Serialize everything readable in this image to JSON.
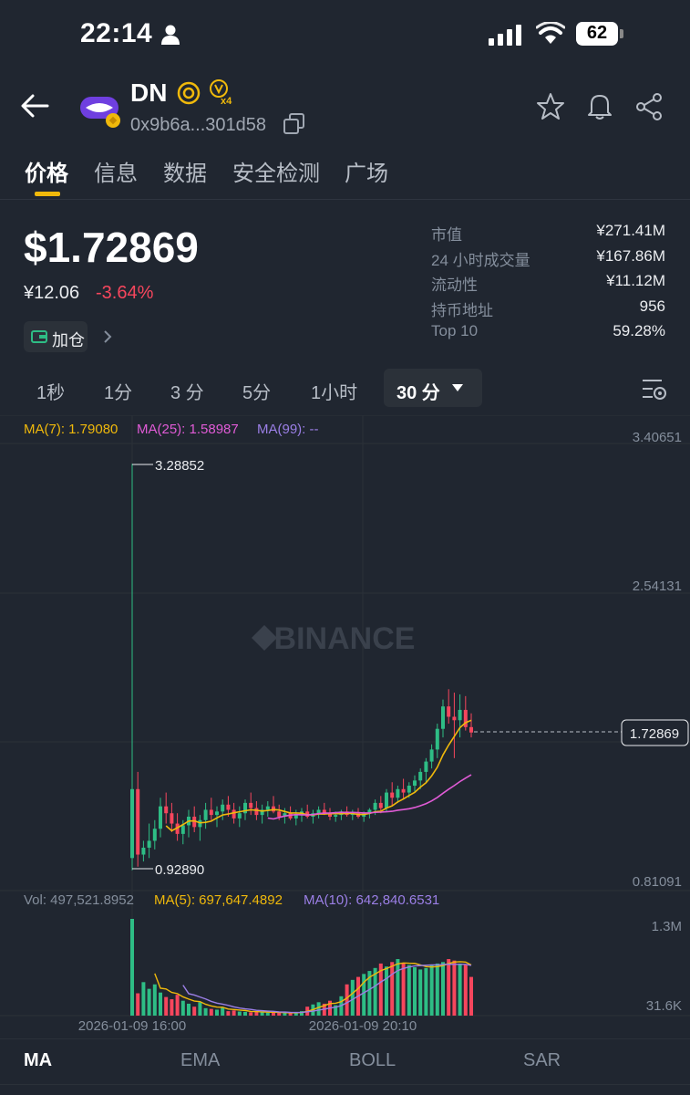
{
  "status": {
    "time": "22:14",
    "battery": "62"
  },
  "token": {
    "name": "DN",
    "address": "0x9b6a...301d58"
  },
  "tabs": [
    "价格",
    "信息",
    "数据",
    "安全检测",
    "广场"
  ],
  "price": {
    "usd": "$1.72869",
    "cny": "¥12.06",
    "change": "-3.64%",
    "add_label": "加仓"
  },
  "stats": [
    {
      "label": "市值",
      "value": "¥271.41M"
    },
    {
      "label": "24 小时成交量",
      "value": "¥167.86M"
    },
    {
      "label": "流动性",
      "value": "¥11.12M"
    },
    {
      "label": "持币地址",
      "value": "956"
    },
    {
      "label": "Top 10",
      "value": "59.28%"
    }
  ],
  "intervals": [
    "1秒",
    "1分",
    "3 分",
    "5分",
    "1小时"
  ],
  "interval_selected": "30 分",
  "ma": {
    "ma7": "MA(7): 1.79080",
    "ma25": "MA(25): 1.58987",
    "ma99": "MA(99): --"
  },
  "price_axis": [
    "3.40651",
    "2.54131",
    "0.81091"
  ],
  "current_price_tag": "1.72869",
  "high_label": "3.28852",
  "low_label": "0.92890",
  "watermark": "BINANCE",
  "volume": {
    "vol": "Vol: 497,521.8952",
    "ma5": "MA(5): 697,647.4892",
    "ma10": "MA(10): 642,840.6531",
    "axis_top": "1.3M",
    "axis_bottom": "31.6K"
  },
  "time_axis": [
    "2026-01-09 16:00",
    "2026-01-09 20:10"
  ],
  "bottom_tabs": [
    "MA",
    "EMA",
    "BOLL",
    "SAR"
  ],
  "colors": {
    "up": "#2ebd85",
    "down": "#f6465d",
    "accent": "#f0b90b",
    "ma7": "#f0b90b",
    "ma25": "#e05bd6",
    "ma10": "#9b7fe6"
  },
  "chart_data": {
    "type": "candlestick",
    "ylim": [
      0.81091,
      3.40651
    ],
    "candles": [
      [
        1.0,
        3.28852,
        0.9289,
        1.4
      ],
      [
        1.4,
        1.5,
        0.95,
        1.02
      ],
      [
        1.02,
        1.1,
        0.98,
        1.06
      ],
      [
        1.06,
        1.2,
        1.0,
        1.1
      ],
      [
        1.1,
        1.22,
        1.05,
        1.17
      ],
      [
        1.17,
        1.35,
        1.12,
        1.3
      ],
      [
        1.3,
        1.38,
        1.2,
        1.26
      ],
      [
        1.26,
        1.32,
        1.15,
        1.2
      ],
      [
        1.2,
        1.26,
        1.1,
        1.14
      ],
      [
        1.14,
        1.22,
        1.08,
        1.19
      ],
      [
        1.19,
        1.28,
        1.12,
        1.24
      ],
      [
        1.24,
        1.3,
        1.15,
        1.18
      ],
      [
        1.18,
        1.25,
        1.1,
        1.22
      ],
      [
        1.22,
        1.32,
        1.17,
        1.28
      ],
      [
        1.28,
        1.35,
        1.22,
        1.25
      ],
      [
        1.25,
        1.3,
        1.18,
        1.27
      ],
      [
        1.27,
        1.34,
        1.22,
        1.31
      ],
      [
        1.31,
        1.36,
        1.24,
        1.28
      ],
      [
        1.28,
        1.32,
        1.2,
        1.23
      ],
      [
        1.23,
        1.3,
        1.18,
        1.26
      ],
      [
        1.26,
        1.34,
        1.22,
        1.32
      ],
      [
        1.32,
        1.38,
        1.25,
        1.29
      ],
      [
        1.29,
        1.33,
        1.22,
        1.25
      ],
      [
        1.25,
        1.31,
        1.2,
        1.28
      ],
      [
        1.28,
        1.33,
        1.24,
        1.3
      ],
      [
        1.3,
        1.36,
        1.26,
        1.27
      ],
      [
        1.27,
        1.31,
        1.22,
        1.24
      ],
      [
        1.24,
        1.29,
        1.2,
        1.26
      ],
      [
        1.26,
        1.3,
        1.22,
        1.23
      ],
      [
        1.23,
        1.28,
        1.19,
        1.25
      ],
      [
        1.25,
        1.29,
        1.21,
        1.27
      ],
      [
        1.27,
        1.31,
        1.23,
        1.24
      ],
      [
        1.24,
        1.28,
        1.2,
        1.26
      ],
      [
        1.26,
        1.3,
        1.23,
        1.28
      ],
      [
        1.28,
        1.32,
        1.25,
        1.26
      ],
      [
        1.26,
        1.29,
        1.22,
        1.24
      ],
      [
        1.24,
        1.27,
        1.21,
        1.25
      ],
      [
        1.25,
        1.28,
        1.22,
        1.27
      ],
      [
        1.27,
        1.3,
        1.24,
        1.25
      ],
      [
        1.25,
        1.28,
        1.22,
        1.26
      ],
      [
        1.26,
        1.29,
        1.23,
        1.24
      ],
      [
        1.24,
        1.27,
        1.21,
        1.26
      ],
      [
        1.26,
        1.29,
        1.23,
        1.28
      ],
      [
        1.28,
        1.34,
        1.25,
        1.32
      ],
      [
        1.32,
        1.36,
        1.26,
        1.29
      ],
      [
        1.29,
        1.4,
        1.27,
        1.38
      ],
      [
        1.38,
        1.44,
        1.3,
        1.35
      ],
      [
        1.35,
        1.42,
        1.32,
        1.4
      ],
      [
        1.4,
        1.46,
        1.34,
        1.38
      ],
      [
        1.38,
        1.44,
        1.35,
        1.42
      ],
      [
        1.42,
        1.48,
        1.38,
        1.45
      ],
      [
        1.45,
        1.52,
        1.4,
        1.5
      ],
      [
        1.5,
        1.58,
        1.44,
        1.56
      ],
      [
        1.56,
        1.66,
        1.52,
        1.63
      ],
      [
        1.63,
        1.78,
        1.58,
        1.75
      ],
      [
        1.75,
        1.92,
        1.7,
        1.88
      ],
      [
        1.88,
        1.98,
        1.78,
        1.82
      ],
      [
        1.82,
        1.96,
        1.58,
        1.8
      ],
      [
        1.8,
        1.95,
        1.7,
        1.86
      ],
      [
        1.86,
        1.94,
        1.74,
        1.76
      ],
      [
        1.76,
        1.84,
        1.7,
        1.72869
      ]
    ],
    "volumes": [
      1300000,
      300000,
      450000,
      360000,
      420000,
      310000,
      250000,
      220000,
      280000,
      200000,
      160000,
      120000,
      180000,
      100000,
      90000,
      80000,
      110000,
      60000,
      70000,
      55000,
      50000,
      45000,
      52000,
      48000,
      40000,
      42000,
      38000,
      36000,
      34000,
      40000,
      60000,
      120000,
      150000,
      180000,
      160000,
      200000,
      140000,
      260000,
      420000,
      480000,
      520000,
      560000,
      600000,
      640000,
      700000,
      660000,
      720000,
      760000,
      700000,
      680000,
      650000,
      620000,
      640000,
      680000,
      700000,
      720000,
      760000,
      740000,
      700000,
      680000,
      520000
    ]
  }
}
